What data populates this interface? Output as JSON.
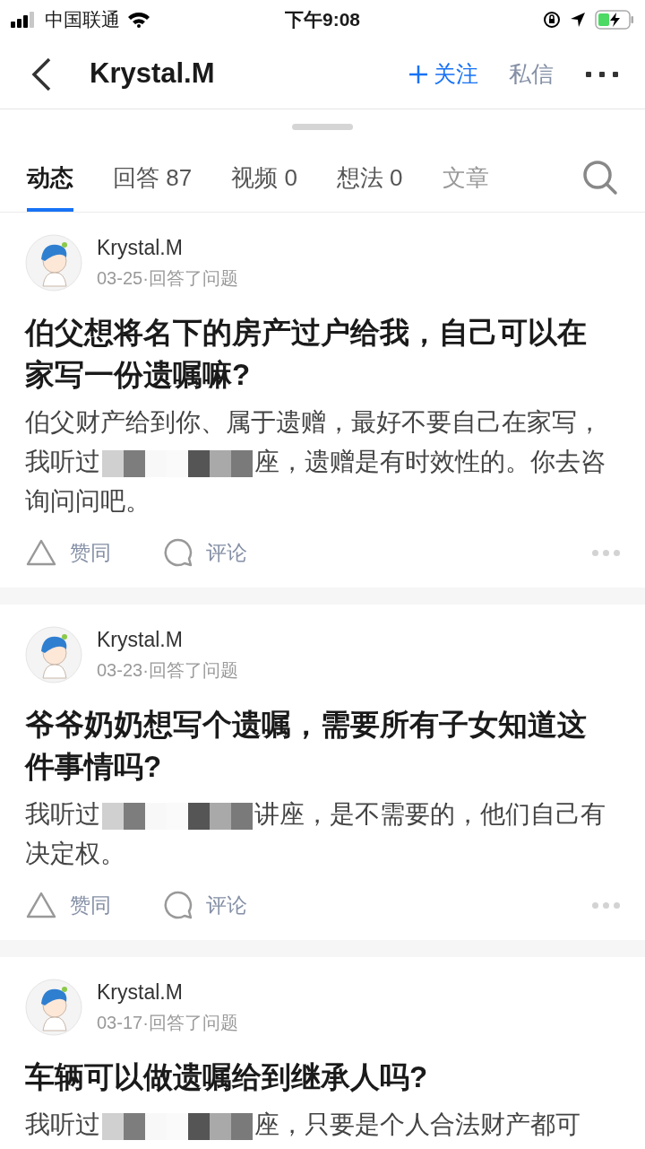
{
  "status_bar": {
    "carrier": "中国联通",
    "time": "下午9:08"
  },
  "header": {
    "title": "Krystal.M",
    "follow": "关注",
    "message": "私信"
  },
  "tabs": [
    {
      "label": "动态",
      "selected": true
    },
    {
      "label": "回答 87",
      "selected": false
    },
    {
      "label": "视频 0",
      "selected": false
    },
    {
      "label": "想法 0",
      "selected": false
    },
    {
      "label": "文章",
      "selected": false
    }
  ],
  "posts": [
    {
      "author": "Krystal.M",
      "date": "03-25",
      "action": "·回答了问题",
      "title": "伯父想将名下的房产过户给我，自己可以在家写一份遗嘱嘛?",
      "excerpt": [
        {
          "kind": "text",
          "text": "伯父财产给到你、属于遗赠，最好不要自己在家写，我听过"
        },
        {
          "kind": "redaction"
        },
        {
          "kind": "text",
          "text": "座，遗赠是有时效性的。你去咨询问问吧。"
        }
      ],
      "like": "赞同",
      "comment": "评论"
    },
    {
      "author": "Krystal.M",
      "date": "03-23",
      "action": "·回答了问题",
      "title": "爷爷奶奶想写个遗嘱，需要所有子女知道这件事情吗?",
      "excerpt": [
        {
          "kind": "text",
          "text": "我听过"
        },
        {
          "kind": "redaction"
        },
        {
          "kind": "text",
          "text": "讲座，是不需要的，他们自己有决定权。"
        }
      ],
      "like": "赞同",
      "comment": "评论"
    },
    {
      "author": "Krystal.M",
      "date": "03-17",
      "action": "·回答了问题",
      "title": "车辆可以做遗嘱给到继承人吗?",
      "excerpt": [
        {
          "kind": "text",
          "text": "我听过"
        },
        {
          "kind": "redaction"
        },
        {
          "kind": "text",
          "text": "座，只要是个人合法财产都可"
        }
      ]
    }
  ]
}
